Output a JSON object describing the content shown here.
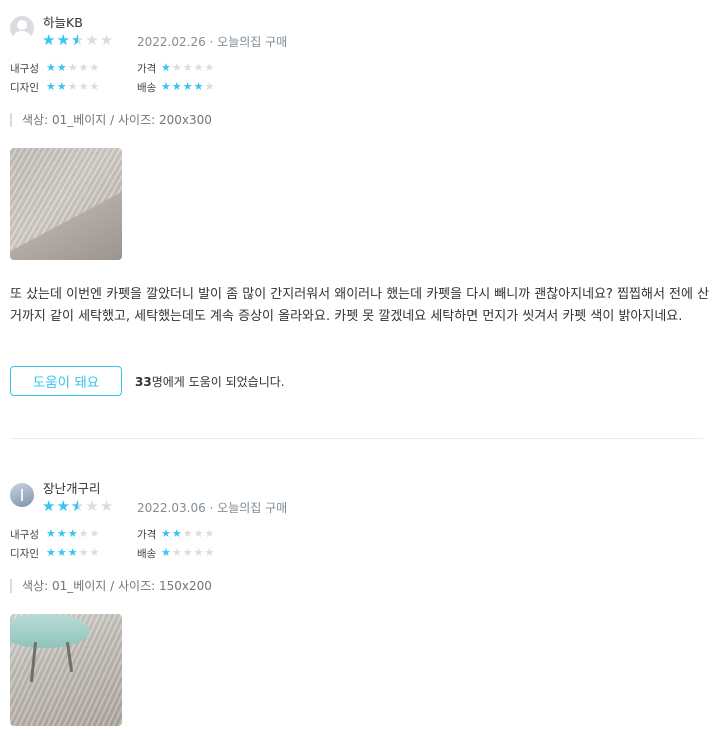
{
  "reviews": [
    {
      "username": "하늘KB",
      "date_source": "2022.02.26 · 오늘의집 구매",
      "rating": 2.5,
      "sub_ratings": [
        {
          "label": "내구성",
          "score": 2
        },
        {
          "label": "가격",
          "score": 1
        },
        {
          "label": "디자인",
          "score": 2
        },
        {
          "label": "배송",
          "score": 4
        }
      ],
      "option": "색상: 01_베이지 / 사이즈: 200x300",
      "text": "또 샀는데 이번엔 카펫을 깔았더니 발이 좀 많이 간지러워서 왜이러나 했는데 카펫을 다시 빼니까 괜찮아지네요? 찝찝해서 전에 산거까지 같이 세탁했고, 세탁했는데도 계속 증상이 올라와요. 카펫 못 깔겠네요 세탁하면 먼지가 씻겨서 카펫 색이 밝아지네요.",
      "helpful_button": "도움이 돼요",
      "helpful_count": "33",
      "helpful_suffix": "명에게 도움이 되었습니다."
    },
    {
      "username": "장난개구리",
      "date_source": "2022.03.06 · 오늘의집 구매",
      "rating": 2.5,
      "sub_ratings": [
        {
          "label": "내구성",
          "score": 3
        },
        {
          "label": "가격",
          "score": 2
        },
        {
          "label": "디자인",
          "score": 3
        },
        {
          "label": "배송",
          "score": 1
        }
      ],
      "option": "색상: 01_베이지 / 사이즈: 150x200"
    }
  ],
  "colors": {
    "star": "#35c5f0",
    "star_empty": "#dadce0",
    "accent": "#35c5f0"
  },
  "icons": [
    "default-avatar-icon",
    "user-avatar-icon",
    "star-icon"
  ]
}
